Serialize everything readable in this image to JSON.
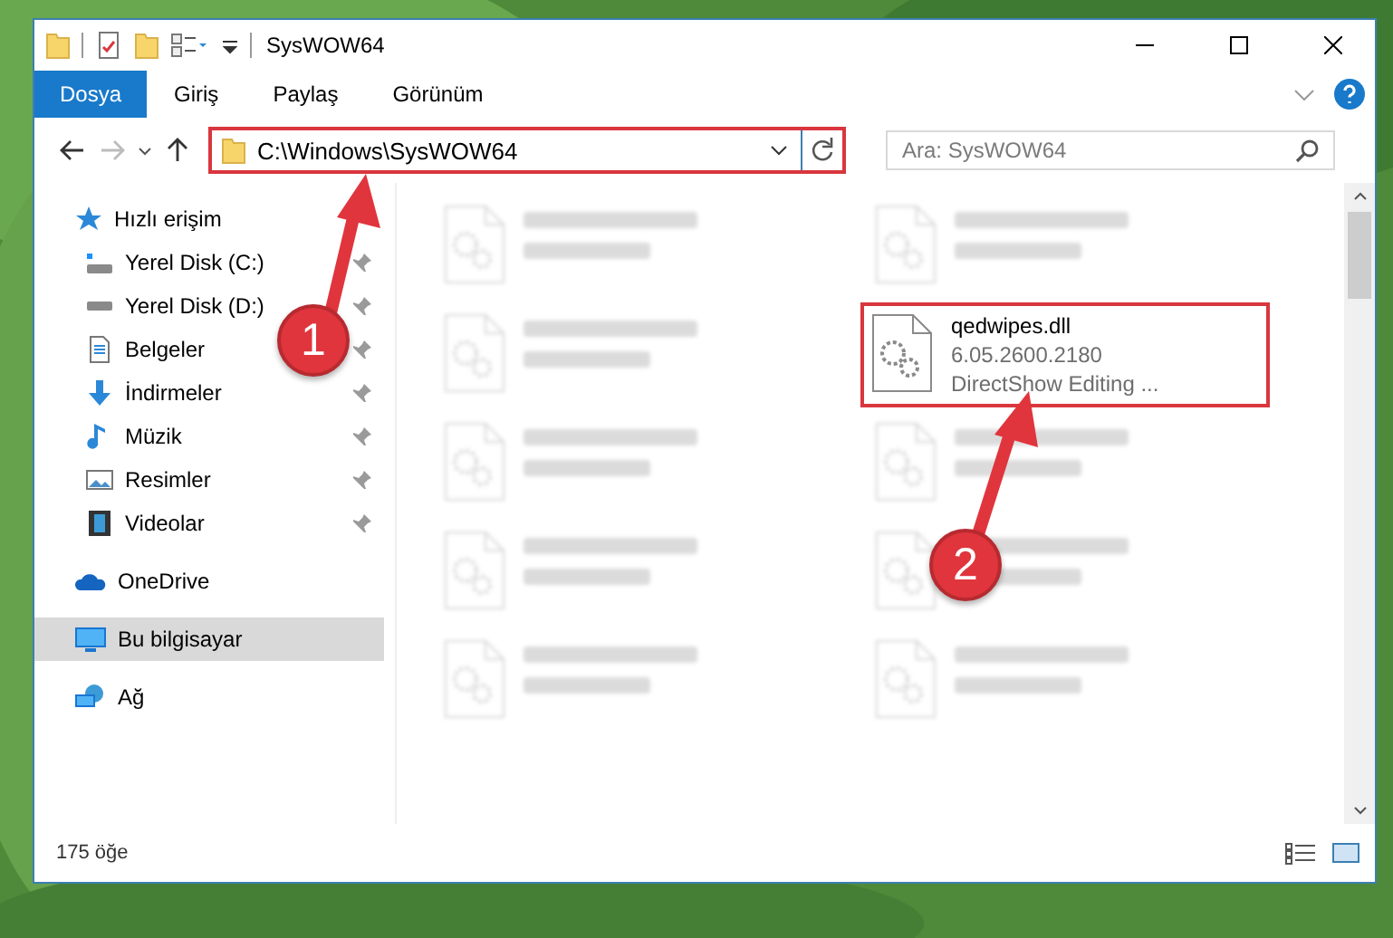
{
  "window": {
    "title": "SysWOW64"
  },
  "ribbon_tabs": [
    {
      "label": "Dosya",
      "selected": true
    },
    {
      "label": "Giriş",
      "selected": false
    },
    {
      "label": "Paylaş",
      "selected": false
    },
    {
      "label": "Görünüm",
      "selected": false
    }
  ],
  "address": {
    "path": "C:\\Windows\\SysWOW64",
    "highlighted": true
  },
  "search": {
    "placeholder": "Ara: SysWOW64"
  },
  "sidebar": {
    "items": [
      {
        "label": "Hızlı erişim",
        "selected": false,
        "children": [
          {
            "label": "Yerel Disk (C:)",
            "selected": false,
            "pinned": true
          },
          {
            "label": "Yerel Disk (D:)",
            "selected": false,
            "pinned": true
          },
          {
            "label": "Belgeler",
            "selected": false,
            "pinned": true
          },
          {
            "label": "İndirmeler",
            "selected": false,
            "pinned": true
          },
          {
            "label": "Müzik",
            "selected": false,
            "pinned": true
          },
          {
            "label": "Resimler",
            "selected": false,
            "pinned": true
          },
          {
            "label": "Videolar",
            "selected": false,
            "pinned": true
          }
        ]
      },
      {
        "label": "OneDrive",
        "selected": false
      },
      {
        "label": "Bu bilgisayar",
        "selected": true
      },
      {
        "label": "Ağ",
        "selected": false
      }
    ]
  },
  "files": [
    {
      "kind": "blurred",
      "highlighted": false
    },
    {
      "kind": "blurred",
      "highlighted": false
    },
    {
      "kind": "blurred",
      "highlighted": false
    },
    {
      "kind": "file",
      "name": "qedwipes.dll",
      "details": [
        "6.05.2600.2180",
        "DirectShow Editing ..."
      ],
      "highlighted": true
    },
    {
      "kind": "blurred",
      "highlighted": false
    },
    {
      "kind": "blurred",
      "highlighted": false
    },
    {
      "kind": "blurred",
      "highlighted": false
    },
    {
      "kind": "blurred",
      "highlighted": false
    },
    {
      "kind": "blurred",
      "highlighted": false
    },
    {
      "kind": "blurred",
      "highlighted": false
    }
  ],
  "status_bar": {
    "count": "175 öğe"
  },
  "annotations": [
    {
      "number": "1"
    },
    {
      "number": "2"
    }
  ]
}
